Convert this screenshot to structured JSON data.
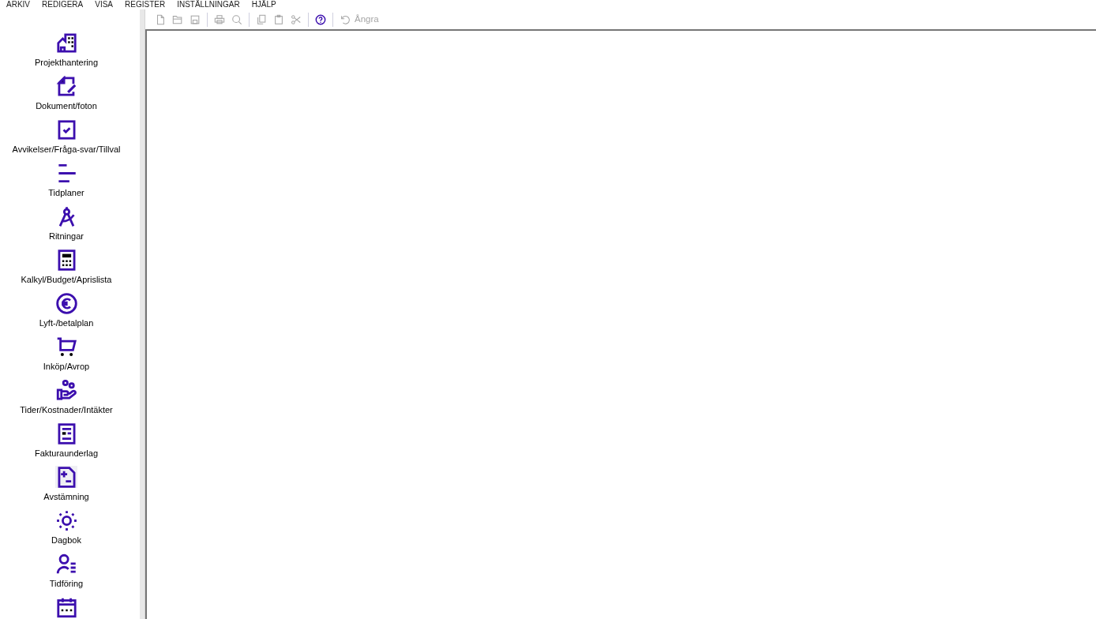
{
  "menu_bar": [
    "ARKIV",
    "REDIGERA",
    "VISA",
    "REGISTER",
    "INSTÄLLNINGAR",
    "HJÄLP"
  ],
  "toolbar": {
    "groups": [
      [
        {
          "disabled": true
        },
        {
          "disabled": true
        },
        {
          "disabled": true
        }
      ],
      [
        {
          "disabled": true
        },
        {
          "disabled": true
        }
      ],
      [
        {
          "disabled": true
        },
        {
          "disabled": true
        },
        {
          "disabled": true
        }
      ],
      [
        {
          "disabled": false
        }
      ],
      [
        {
          "label": "Ångra",
          "disabled": true
        }
      ]
    ]
  },
  "sidebar": {
    "items": [
      {
        "label": "Projekthantering",
        "highlighted": false
      },
      {
        "label": "Dokument/foton",
        "highlighted": false
      },
      {
        "label": "Avvikelser/Fråga-svar/Tillval",
        "highlighted": false
      },
      {
        "label": "Tidplaner",
        "highlighted": false
      },
      {
        "label": "Ritningar",
        "highlighted": false
      },
      {
        "label": "Kalkyl/Budget/Aprislista",
        "highlighted": false
      },
      {
        "label": "Lyft-/betalplan",
        "highlighted": false
      },
      {
        "label": "Inköp/Avrop",
        "highlighted": false
      },
      {
        "label": "Tider/Kostnader/Intäkter",
        "highlighted": false
      },
      {
        "label": "Fakturaunderlag",
        "highlighted": false
      },
      {
        "label": "Avstämning",
        "highlighted": true
      },
      {
        "label": "Dagbok",
        "highlighted": false
      },
      {
        "label": "Tidföring",
        "highlighted": false
      },
      {
        "highlighted": false
      }
    ]
  }
}
